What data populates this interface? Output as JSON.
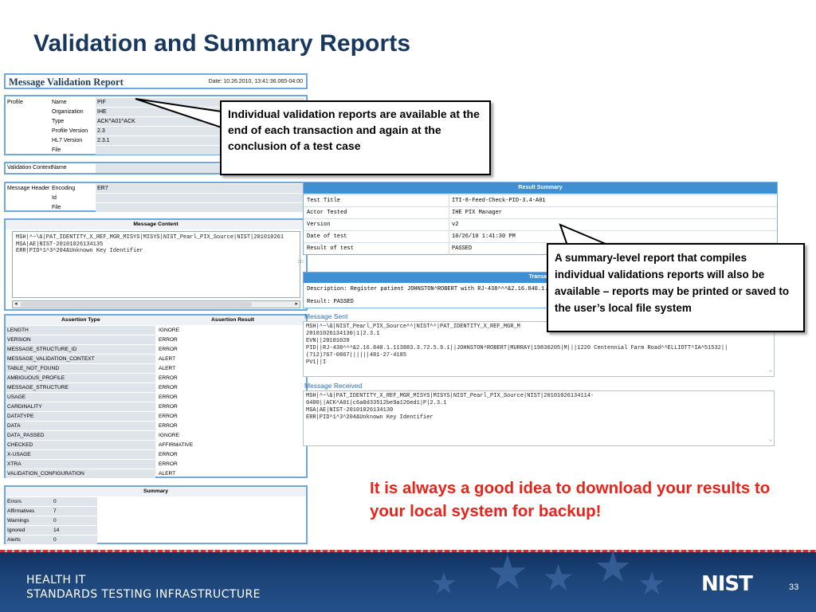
{
  "slide": {
    "title": "Validation and Summary Reports",
    "callout_individual": "Individual validation reports are available at the end of each transaction and again at the conclusion of a test case",
    "callout_summary": "A summary-level report that compiles individual validations reports will also be available – reports may be printed or saved to the user’s local file system",
    "advice": "It is always a good idea to download your results to your local system for backup!",
    "page_number": "33"
  },
  "footer": {
    "org_line1": "HEALTH IT",
    "org_line2": "STANDARDS TESTING INFRASTRUCTURE",
    "logo_text": "NIST"
  },
  "validation_report": {
    "title": "Message Validation Report",
    "date": "Date: 10.26.2010, 13:41:36.065-04:00",
    "profile": {
      "section_label": "Profile",
      "rows": [
        {
          "key": "Name",
          "value": "PIF"
        },
        {
          "key": "Organization",
          "value": "IHE"
        },
        {
          "key": "Type",
          "value": "ACK^A01^ACK"
        },
        {
          "key": "Profile Version",
          "value": "2.3"
        },
        {
          "key": "HL7 Version",
          "value": "2.3.1"
        },
        {
          "key": "File",
          "value": ""
        }
      ]
    },
    "validation_context": {
      "section_label": "Validation Context",
      "key": "Name",
      "value": ""
    },
    "message_header": {
      "section_label": "Message Header",
      "rows": [
        {
          "key": "Encoding",
          "value": "ER7"
        },
        {
          "key": "Id",
          "value": ""
        },
        {
          "key": "File",
          "value": ""
        }
      ]
    },
    "message_content": {
      "header": "Message Content",
      "lines": [
        "MSH|^~\\&|PAT_IDENTITY_X_REF_MGR_MISYS|MISYS|NIST_Pearl_PIX_Source|NIST|201010261",
        "MSA|AE|NIST-20101026134135",
        "ERR|PID^1^3^204&Unknown Key Identifier"
      ]
    },
    "assertions": {
      "col_type": "Assertion Type",
      "col_result": "Assertion Result",
      "rows": [
        {
          "type": "LENGTH",
          "result": "IGNORE"
        },
        {
          "type": "VERSION",
          "result": "ERROR"
        },
        {
          "type": "MESSAGE_STRUCTURE_ID",
          "result": "ERROR"
        },
        {
          "type": "MESSAGE_VALIDATION_CONTEXT",
          "result": "ALERT"
        },
        {
          "type": "TABLE_NOT_FOUND",
          "result": "ALERT"
        },
        {
          "type": "AMBIGUOUS_PROFILE",
          "result": "ERROR"
        },
        {
          "type": "MESSAGE_STRUCTURE",
          "result": "ERROR"
        },
        {
          "type": "USAGE",
          "result": "ERROR"
        },
        {
          "type": "CARDINALITY",
          "result": "ERROR"
        },
        {
          "type": "DATATYPE",
          "result": "ERROR"
        },
        {
          "type": "DATA",
          "result": "ERROR"
        },
        {
          "type": "DATA_PASSED",
          "result": "IGNORE"
        },
        {
          "type": "CHECKED",
          "result": "AFFIRMATIVE"
        },
        {
          "type": "X-USAGE",
          "result": "ERROR"
        },
        {
          "type": "XTRA",
          "result": "ERROR"
        },
        {
          "type": "VALIDATION_CONFIGURATION",
          "result": "ALERT"
        }
      ]
    },
    "summary": {
      "header": "Summary",
      "rows": [
        {
          "key": "Errors",
          "value": "0"
        },
        {
          "key": "Affirmatives",
          "value": "7"
        },
        {
          "key": "Warnings",
          "value": "0"
        },
        {
          "key": "Ignored",
          "value": "14"
        },
        {
          "key": "Alerts",
          "value": "0"
        }
      ]
    }
  },
  "result_summary": {
    "header": "Result Summary",
    "rows": [
      {
        "key": "Test Title",
        "value": "ITI-8-Feed-Check-PID-3.4-A01"
      },
      {
        "key": "Actor Tested",
        "value": "IHE PIX Manager"
      },
      {
        "key": "Version",
        "value": "v2"
      },
      {
        "key": "Date of test",
        "value": "10/26/10 1:41:30 PM"
      },
      {
        "key": "Result of test",
        "value": "PASSED"
      }
    ]
  },
  "transaction": {
    "header": "Transact",
    "description": "Description: Register patient JOHNSTON^ROBERT with RJ-438^^^&2.16.840.1.11",
    "result": "Result: PASSED",
    "message_sent_label": "Message Sent",
    "message_sent_lines": [
      "MSH|^~\\&|NIST_Pearl_PIX_Source^^|NIST^^|PAT_IDENTITY_X_REF_MGR_M",
      "20101026134130|1|2.3.1",
      "EVN||20101020",
      "PID||RJ-438^^^&2.16.840.1.113883.3.72.5.9.1||JOHNSTON^ROBERT|MURRAY|19830205|M|||1220 Centennial Farm Road^^ELLIOTT^IA^51532||",
      "(712)767-0867||||||481-27-4185",
      "PV1||I"
    ],
    "message_received_label": "Message Received",
    "message_received_lines": [
      "MSH|^~\\&|PAT_IDENTITY_X_REF_MGR_MISYS|MISYS|NIST_Pearl_PIX_Source|NIST|20101026134114-",
      "0400||ACK^A01|c6a0d33512be9a126ed1|P|2.3.1",
      "MSA|AE|NIST-20101026134130",
      "ERR|PID^1^3^204&Unknown Key Identifier"
    ]
  },
  "colors": {
    "title": "#17375e",
    "advice": "#e8231a",
    "panel_border": "#6fa8dc",
    "result_header": "#3f8fd2",
    "footer": "#1c4478"
  }
}
